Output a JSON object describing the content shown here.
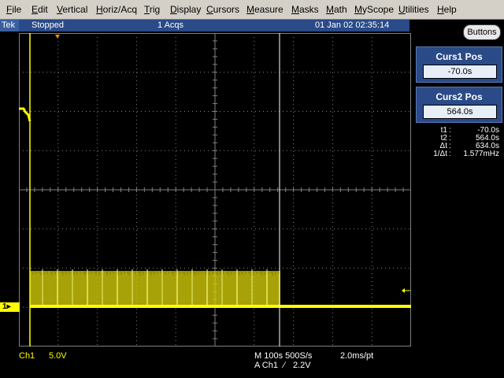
{
  "menu": [
    "File",
    "Edit",
    "Vertical",
    "Horiz/Acq",
    "Trig",
    "Display",
    "Cursors",
    "Measure",
    "Masks",
    "Math",
    "MyScope",
    "Utilities",
    "Help"
  ],
  "status": {
    "brand": "Tek",
    "state": "Stopped",
    "acqs": "1 Acqs",
    "datetime": "01 Jan 02 02:35:14",
    "buttons_label": "Buttons"
  },
  "cursor_panel": {
    "curs1_title": "Curs1 Pos",
    "curs1_value": "-70.0s",
    "curs2_title": "Curs2 Pos",
    "curs2_value": "564.0s"
  },
  "readouts": [
    {
      "key": "t1",
      "value": "-70.0s"
    },
    {
      "key": "t2",
      "value": "564.0s"
    },
    {
      "key": "Δt",
      "value": "634.0s"
    },
    {
      "key": "1/Δt",
      "value": "1.577mHz"
    }
  ],
  "footer": {
    "channel": "Ch1",
    "scale": "5.0V",
    "timebase": "M 100s 500S/s",
    "trigger_src": "A  Ch1",
    "trigger_slope": "∕",
    "trigger_level": "2.2V",
    "record": "2.0ms/pt"
  },
  "channel_marker": "1",
  "colors": {
    "trace": "#ffff00",
    "grid": "#808080",
    "panel": "#2a4a88"
  }
}
